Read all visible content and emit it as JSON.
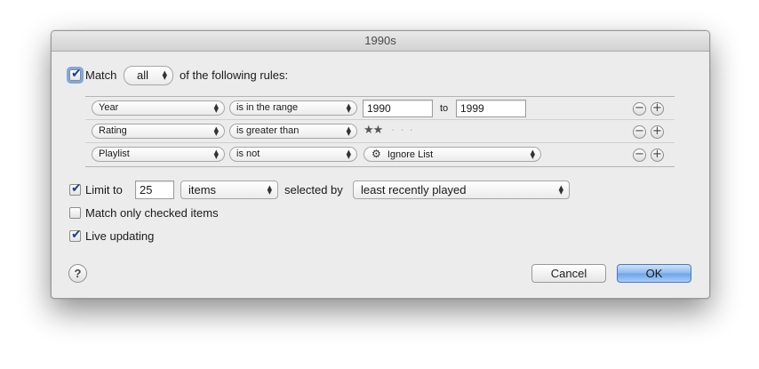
{
  "window": {
    "title": "1990s"
  },
  "match": {
    "prefix": "Match",
    "mode": "all",
    "suffix": "of the following rules:",
    "checked": true
  },
  "rules": [
    {
      "field": "Year",
      "operator": "is in the range",
      "from": "1990",
      "to_label": "to",
      "to": "1999"
    },
    {
      "field": "Rating",
      "operator": "is greater than",
      "stars": "★★",
      "rating_value": 2,
      "rating_max": 5
    },
    {
      "field": "Playlist",
      "operator": "is not",
      "playlist": "Ignore List",
      "playlist_icon": "gear-icon"
    }
  ],
  "rule_controls": {
    "remove_icon": "minus-icon",
    "add_icon": "plus-icon"
  },
  "limit": {
    "checked": true,
    "label": "Limit to",
    "value": "25",
    "unit": "items",
    "selected_by_label": "selected by",
    "selected_by": "least recently played"
  },
  "match_checked_only": {
    "checked": false,
    "label": "Match only checked items"
  },
  "live_updating": {
    "checked": true,
    "label": "Live updating"
  },
  "buttons": {
    "help": "?",
    "cancel": "Cancel",
    "ok": "OK"
  },
  "colors": {
    "default_button": "#6da4e8",
    "focus_ring": "#7fa8e0",
    "check_mark": "#1f3f8a"
  }
}
